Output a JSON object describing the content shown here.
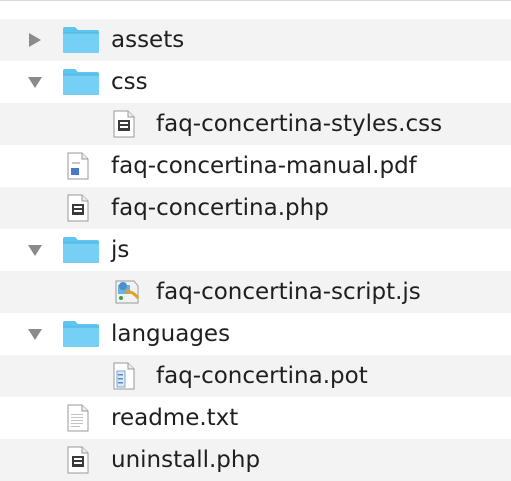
{
  "file_tree": {
    "items": [
      {
        "label": "assets",
        "kind": "folder",
        "expanded": false,
        "depth": 0,
        "icon": "folder-icon"
      },
      {
        "label": "css",
        "kind": "folder",
        "expanded": true,
        "depth": 0,
        "icon": "folder-icon"
      },
      {
        "label": "faq-concertina-styles.css",
        "kind": "file",
        "depth": 1,
        "icon": "document-icon"
      },
      {
        "label": "faq-concertina-manual.pdf",
        "kind": "file",
        "depth": 0,
        "icon": "pdf-icon"
      },
      {
        "label": "faq-concertina.php",
        "kind": "file",
        "depth": 0,
        "icon": "document-icon"
      },
      {
        "label": "js",
        "kind": "folder",
        "expanded": true,
        "depth": 0,
        "icon": "folder-icon"
      },
      {
        "label": "faq-concertina-script.js",
        "kind": "file",
        "depth": 1,
        "icon": "script-icon"
      },
      {
        "label": "languages",
        "kind": "folder",
        "expanded": true,
        "depth": 0,
        "icon": "folder-icon"
      },
      {
        "label": "faq-concertina.pot",
        "kind": "file",
        "depth": 1,
        "icon": "pot-file-icon"
      },
      {
        "label": "readme.txt",
        "kind": "file",
        "depth": 0,
        "icon": "text-file-icon"
      },
      {
        "label": "uninstall.php",
        "kind": "file",
        "depth": 0,
        "icon": "document-icon"
      }
    ]
  },
  "colors": {
    "folder": "#5ec4f0",
    "folder_tab": "#76cff5",
    "toggle": "#8a8a8a",
    "row_alt": "#f3f3f3"
  }
}
